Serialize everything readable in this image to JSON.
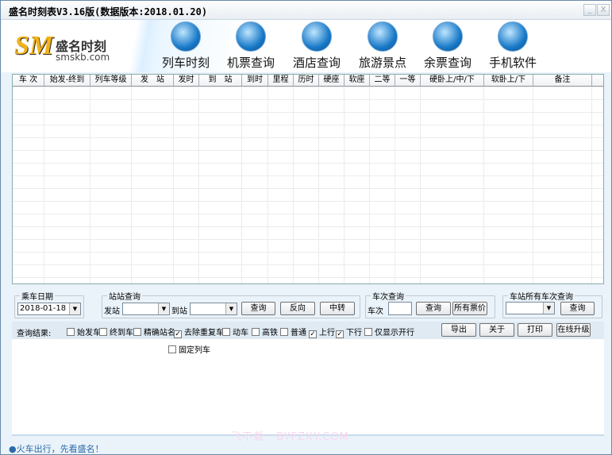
{
  "window": {
    "title": "盛名时刻表V3.16版(数据版本:2018.01.20)",
    "minimize": "_",
    "close": "X"
  },
  "logo": {
    "sm": "SM",
    "cn": "盛名时刻",
    "en": "smskb.com"
  },
  "nav": [
    {
      "label": "列车时刻",
      "icon": "train-icon"
    },
    {
      "label": "机票查询",
      "icon": "airplane-icon"
    },
    {
      "label": "酒店查询",
      "icon": "hotel-icon"
    },
    {
      "label": "旅游景点",
      "icon": "globe-icon"
    },
    {
      "label": "余票查询",
      "icon": "windows-icon"
    },
    {
      "label": "手机软件",
      "icon": "java-icon"
    }
  ],
  "table": {
    "columns": [
      "车 次",
      "始发-终到",
      "列车等级",
      "发　站",
      "发时",
      "到　站",
      "到时",
      "里程",
      "历时",
      "硬座",
      "软座",
      "二等",
      "一等",
      "硬卧上/中/下",
      "软卧上/下",
      "备注"
    ]
  },
  "date_group": {
    "legend": "乘车日期",
    "value": "2018-01-18"
  },
  "station_group": {
    "legend": "站站查询",
    "from_label": "发站",
    "to_label": "到站",
    "from_value": "",
    "to_value": "",
    "query": "查询",
    "reverse": "反向",
    "transfer": "中转"
  },
  "train_group": {
    "legend": "车次查询",
    "label": "车次",
    "value": "",
    "query": "查询",
    "all_prices": "所有票价"
  },
  "station_all_group": {
    "legend": "车站所有车次查询",
    "value": "",
    "query": "查询"
  },
  "results": {
    "label": "查询结果:",
    "filters": [
      {
        "label": "始发车",
        "checked": false
      },
      {
        "label": "终到车",
        "checked": false
      },
      {
        "label": "精确站名",
        "checked": false
      },
      {
        "label": "去除重复车",
        "checked": true
      },
      {
        "label": "动车",
        "checked": false
      },
      {
        "label": "高铁",
        "checked": false
      },
      {
        "label": "普通",
        "checked": false
      },
      {
        "label": "上行",
        "checked": true
      },
      {
        "label": "下行",
        "checked": true
      },
      {
        "label": "仅显示开行",
        "checked": false
      }
    ],
    "fixed_train": {
      "label": "固定列车",
      "checked": false
    }
  },
  "actions": {
    "export": "导出",
    "about": "关于",
    "print": "打印",
    "upgrade": "在线升级"
  },
  "status": "●火车出行，先看盛名！",
  "watermark": "飞不载 · BYFZXY.COM"
}
